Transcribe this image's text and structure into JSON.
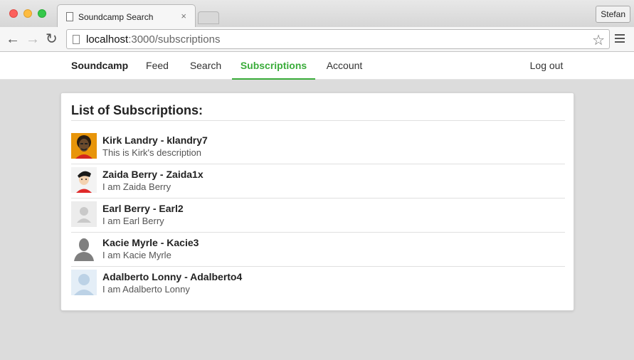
{
  "browser": {
    "tab_title": "Soundcamp Search",
    "tab_close": "×",
    "profile": "Stefan",
    "url_host": "localhost",
    "url_rest": ":3000/subscriptions",
    "back": "←",
    "forward": "→",
    "reload": "↻",
    "star": "☆"
  },
  "nav": {
    "brand": "Soundcamp",
    "feed": "Feed",
    "search": "Search",
    "subscriptions": "Subscriptions",
    "account": "Account",
    "logout": "Log out",
    "active_color": "#3aac3a"
  },
  "card": {
    "title": "List of Subscriptions:",
    "items": [
      {
        "name": "Kirk Landry - klandry7",
        "description": "This is Kirk's description",
        "avatar": "portrait-orange-bg"
      },
      {
        "name": "Zaida Berry - Zaida1x",
        "description": "I am Zaida Berry",
        "avatar": "cartoon-person"
      },
      {
        "name": "Earl Berry - Earl2",
        "description": "I am Earl Berry",
        "avatar": "default-avatar-light"
      },
      {
        "name": "Kacie Myrle - Kacie3",
        "description": "I am Kacie Myrle",
        "avatar": "silhouette-gray"
      },
      {
        "name": "Adalberto Lonny - Adalberto4",
        "description": "I am Adalberto Lonny",
        "avatar": "default-avatar-blue"
      }
    ]
  }
}
